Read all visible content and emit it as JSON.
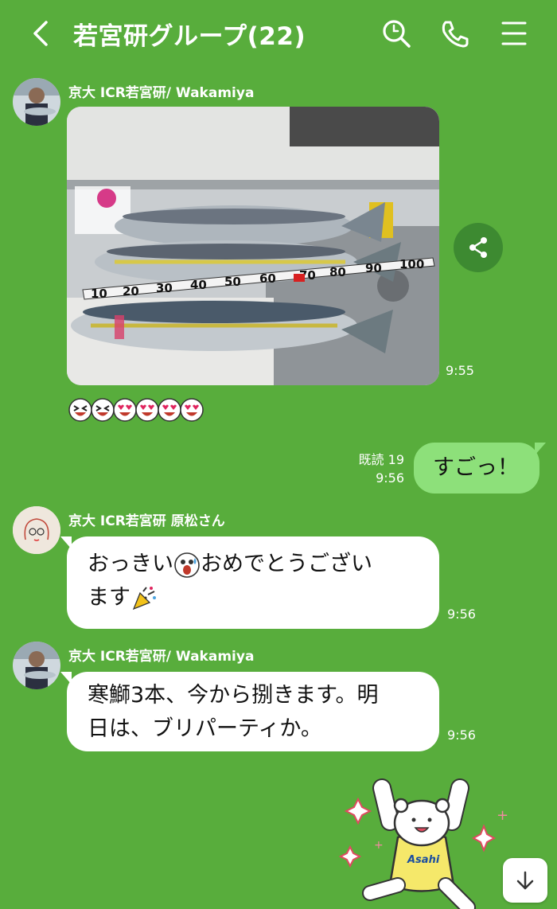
{
  "header": {
    "title": "若宮研グループ(22)"
  },
  "messages": [
    {
      "sender": "京大 ICR若宮研/ Wakamiya",
      "time": "9:55"
    },
    {
      "time": "9:56",
      "read": "既読 19",
      "text": "すごっ！"
    },
    {
      "sender": "京大 ICR若宮研 原松さん",
      "line1": "おっきい",
      "line1b": "おめでとうござい",
      "line2": "ます",
      "time": "9:56"
    },
    {
      "sender": "京大 ICR若宮研/ Wakamiya",
      "line1": "寒鰤3本、今から捌きます。明",
      "line2": "日は、ブリパーティか。",
      "time": "9:56"
    }
  ],
  "photo": {
    "tape_numbers": [
      "10",
      "20",
      "30",
      "40",
      "50",
      "60",
      "70",
      "80",
      "90",
      "100"
    ]
  },
  "sticker": {
    "brand": "Asahi"
  },
  "colors": {
    "background": "#58ad3c",
    "out_bubble": "#8de07a",
    "in_bubble": "#ffffff"
  }
}
